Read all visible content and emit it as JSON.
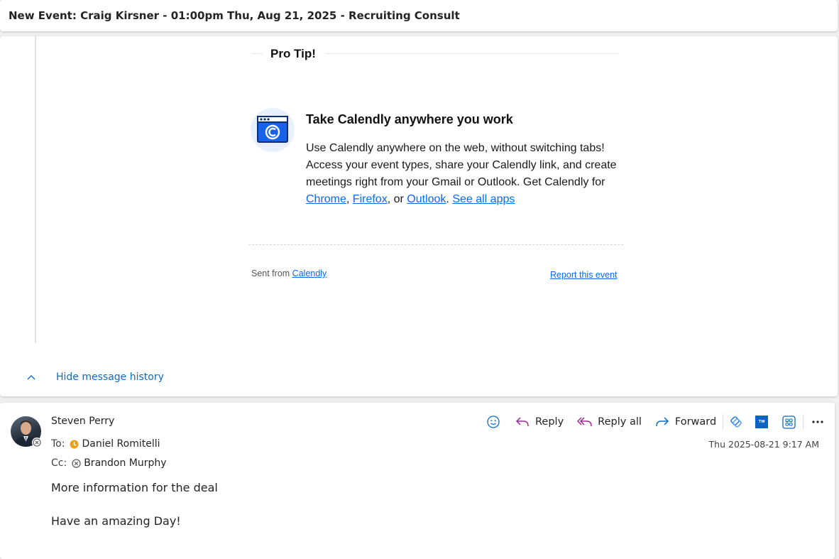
{
  "subject": "New Event: Craig Kirsner - 01:00pm Thu, Aug 21, 2025 - Recruiting Consult",
  "quoted_message": {
    "pro_tip_title": "Pro Tip!",
    "promo_title": "Take Calendly anywhere you work",
    "promo_text": "Use Calendly anywhere on the web, without switching tabs! Access your event types, share your Calendly link, and create meetings right from your Gmail or Outlook. Get Calendly for",
    "links": {
      "chrome": "Chrome",
      "firefox": "Firefox",
      "or_text": "or",
      "outlook": "Outlook",
      "see_all": "See all apps"
    },
    "sent_from_text": "Sent from",
    "sent_from_link": "Calendly",
    "report_link": "Report this event"
  },
  "hide_history_label": "Hide message history",
  "message": {
    "sender": "Steven Perry",
    "to_label": "To:",
    "to": "Daniel Romitelli",
    "cc_label": "Cc:",
    "cc": "Brandon Murphy",
    "timestamp": "Thu 2025-08-21 9:17 AM",
    "body_line1": "More information for the deal",
    "body_line2": "Have an amazing Day!"
  },
  "actions": {
    "reply": "Reply",
    "reply_all": "Reply all",
    "forward": "Forward",
    "addin_badge": "TW"
  },
  "colors": {
    "link": "#0b6be6",
    "accent": "#0f6cbd",
    "reply_icon": "#9b2d8f",
    "forward_icon": "#0f6cbd",
    "presence_away": "#e8a317"
  },
  "icons": [
    "smile-icon",
    "reply-icon",
    "reply-all-icon",
    "forward-icon",
    "loop-icon",
    "addin-icon",
    "apps-icon",
    "more-icon",
    "chevron-up-icon",
    "calendly-app-icon"
  ]
}
